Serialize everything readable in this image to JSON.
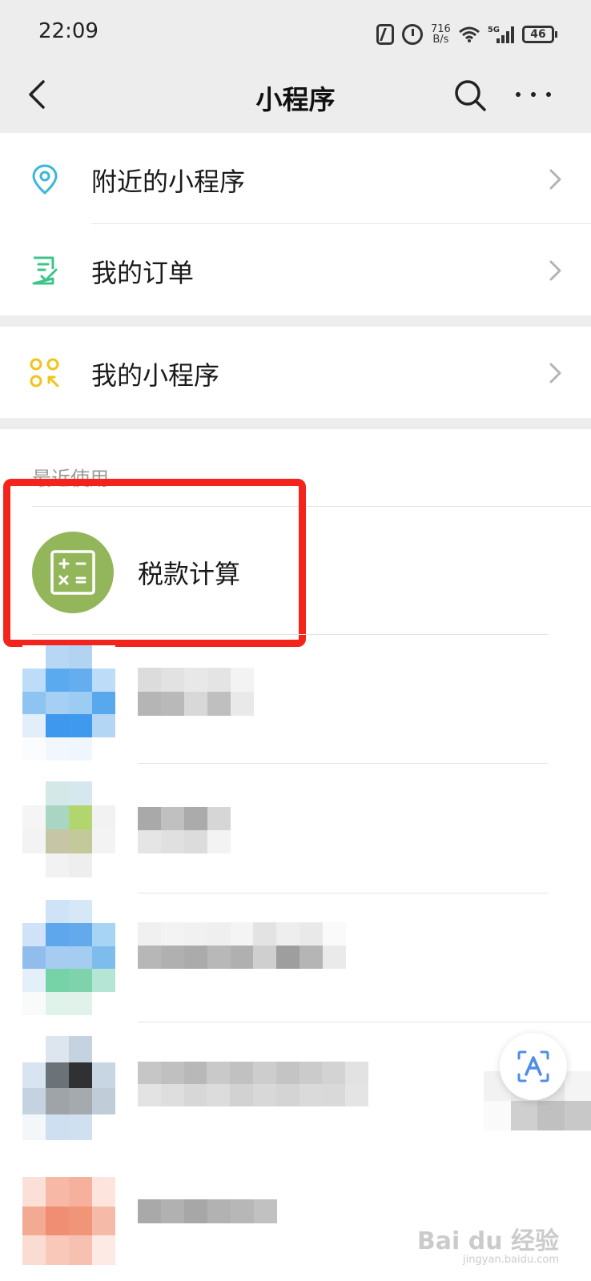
{
  "status_bar": {
    "time": "22:09",
    "net_speed_value": "716",
    "net_speed_unit": "B/s",
    "network_type": "5G",
    "battery": "46"
  },
  "header": {
    "title": "小程序"
  },
  "menu": {
    "items": [
      {
        "label": "附近的小程序",
        "icon": "location-pin-icon",
        "icon_color": "#3bb7d8"
      },
      {
        "label": "我的订单",
        "icon": "order-checklist-icon",
        "icon_color": "#3cc48a"
      },
      {
        "label": "我的小程序",
        "icon": "mini-program-grid-icon",
        "icon_color": "#f0c419"
      }
    ]
  },
  "recent": {
    "section_title": "最近使用",
    "items": [
      {
        "name": "税款计算",
        "icon": "calculator-icon",
        "avatar_color": "#93b65a"
      }
    ]
  },
  "watermark": {
    "brand": "Bai du 经验",
    "url": "jingyan.baidu.com"
  },
  "colors": {
    "header_bg": "#ededed",
    "highlight": "#f2241c"
  }
}
